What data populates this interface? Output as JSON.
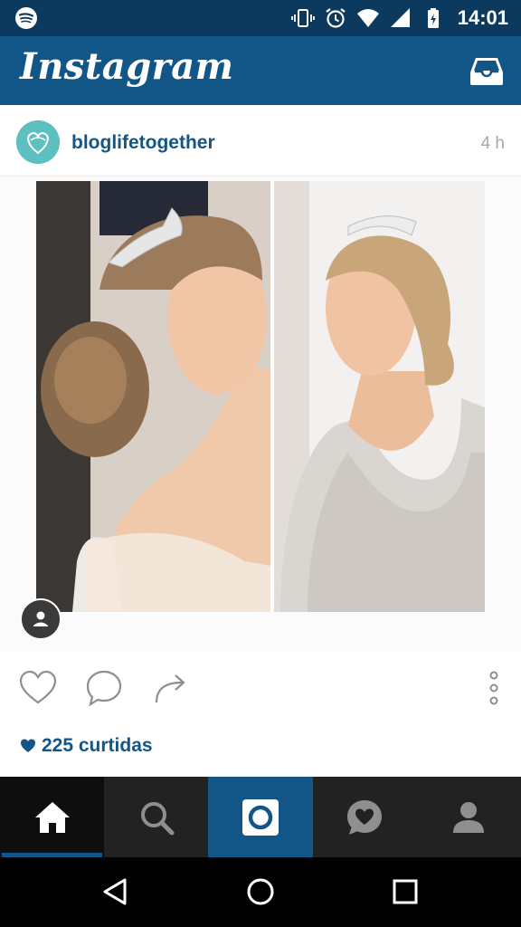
{
  "status_bar": {
    "time": "14:01"
  },
  "app_bar": {
    "title": "Instagram"
  },
  "post": {
    "username": "bloglifetogether",
    "time_ago": "4 h",
    "likes_text": "225 curtidas"
  },
  "tabs": [
    {
      "name": "home-icon"
    },
    {
      "name": "search-icon"
    },
    {
      "name": "camera-icon"
    },
    {
      "name": "activity-icon"
    },
    {
      "name": "profile-icon"
    }
  ],
  "colors": {
    "status_bar": "#0c3a5e",
    "brand": "#125688",
    "tab_bar": "#222222",
    "nav_bar": "#000000"
  }
}
